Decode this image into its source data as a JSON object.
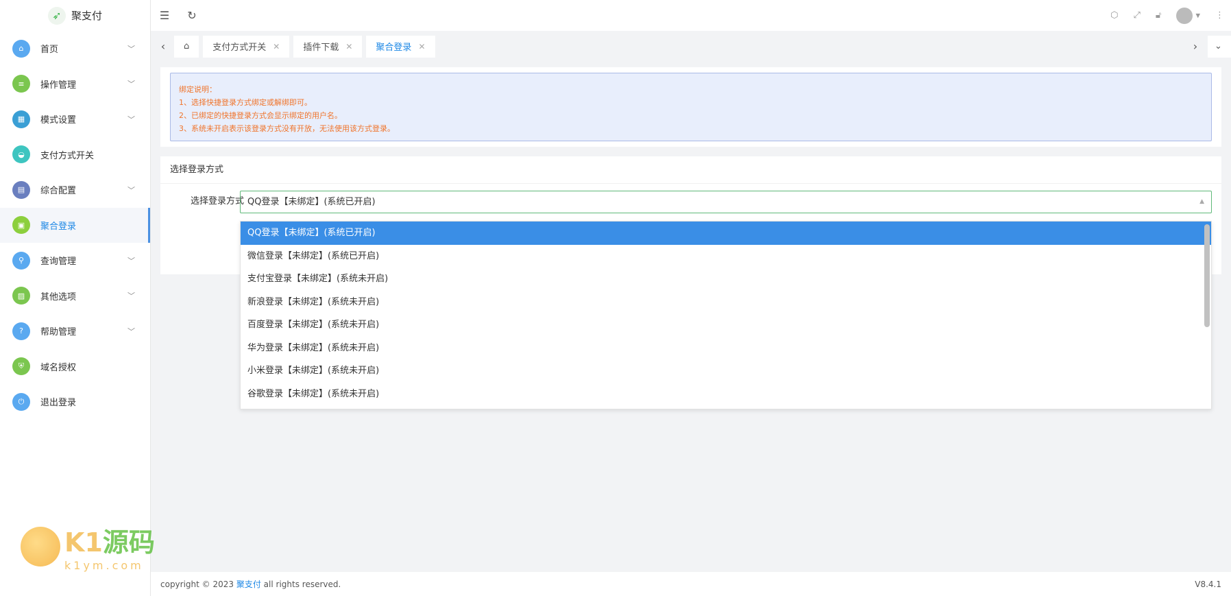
{
  "app": {
    "title": "聚支付"
  },
  "sidebar": {
    "items": [
      {
        "label": "首页",
        "icon": "home-icon",
        "color": "#5aa9f0",
        "chev": true
      },
      {
        "label": "操作管理",
        "icon": "sliders-icon",
        "color": "#7bc64f",
        "chev": true
      },
      {
        "label": "模式设置",
        "icon": "grid-icon",
        "color": "#3a9fd5",
        "chev": true
      },
      {
        "label": "支付方式开关",
        "icon": "toggle-icon",
        "color": "#3ec5c0",
        "chev": false
      },
      {
        "label": "综合配置",
        "icon": "book-icon",
        "color": "#6a7fbf",
        "chev": true
      },
      {
        "label": "聚合登录",
        "icon": "login-icon",
        "color": "#8ccf3d",
        "chev": false
      },
      {
        "label": "查询管理",
        "icon": "search-icon",
        "color": "#5aa9f0",
        "chev": true
      },
      {
        "label": "其他选项",
        "icon": "image-icon",
        "color": "#7bc64f",
        "chev": true
      },
      {
        "label": "帮助管理",
        "icon": "help-icon",
        "color": "#5aa9f0",
        "chev": true
      },
      {
        "label": "域名授权",
        "icon": "shield-icon",
        "color": "#7bc64f",
        "chev": false
      },
      {
        "label": "退出登录",
        "icon": "power-icon",
        "color": "#5aa9f0",
        "chev": false
      }
    ]
  },
  "tabs": [
    {
      "label": "支付方式开关"
    },
    {
      "label": "插件下载"
    },
    {
      "label": "聚合登录"
    }
  ],
  "notice": {
    "title": "绑定说明：",
    "lines": [
      "1、选择快捷登录方式绑定或解绑即可。",
      "2、已绑定的快捷登录方式会显示绑定的用户名。",
      "3、系统未开启表示该登录方式没有开放，无法使用该方式登录。"
    ]
  },
  "card": {
    "title": "选择登录方式",
    "label": "选择登录方式",
    "value": "QQ登录【未绑定】(系统已开启)"
  },
  "options": [
    "QQ登录【未绑定】(系统已开启)",
    "微信登录【未绑定】(系统已开启)",
    "支付宝登录【未绑定】(系统未开启)",
    "新浪登录【未绑定】(系统未开启)",
    "百度登录【未绑定】(系统未开启)",
    "华为登录【未绑定】(系统未开启)",
    "小米登录【未绑定】(系统未开启)",
    "谷歌登录【未绑定】(系统未开启)"
  ],
  "footer": {
    "prefix": "copyright © 2023 ",
    "brand": "聚支付",
    "suffix": " all rights reserved.",
    "version": "V8.4.1"
  },
  "watermark": {
    "text1": "K1",
    "text2": "源码",
    "url": "k1ym.com"
  }
}
